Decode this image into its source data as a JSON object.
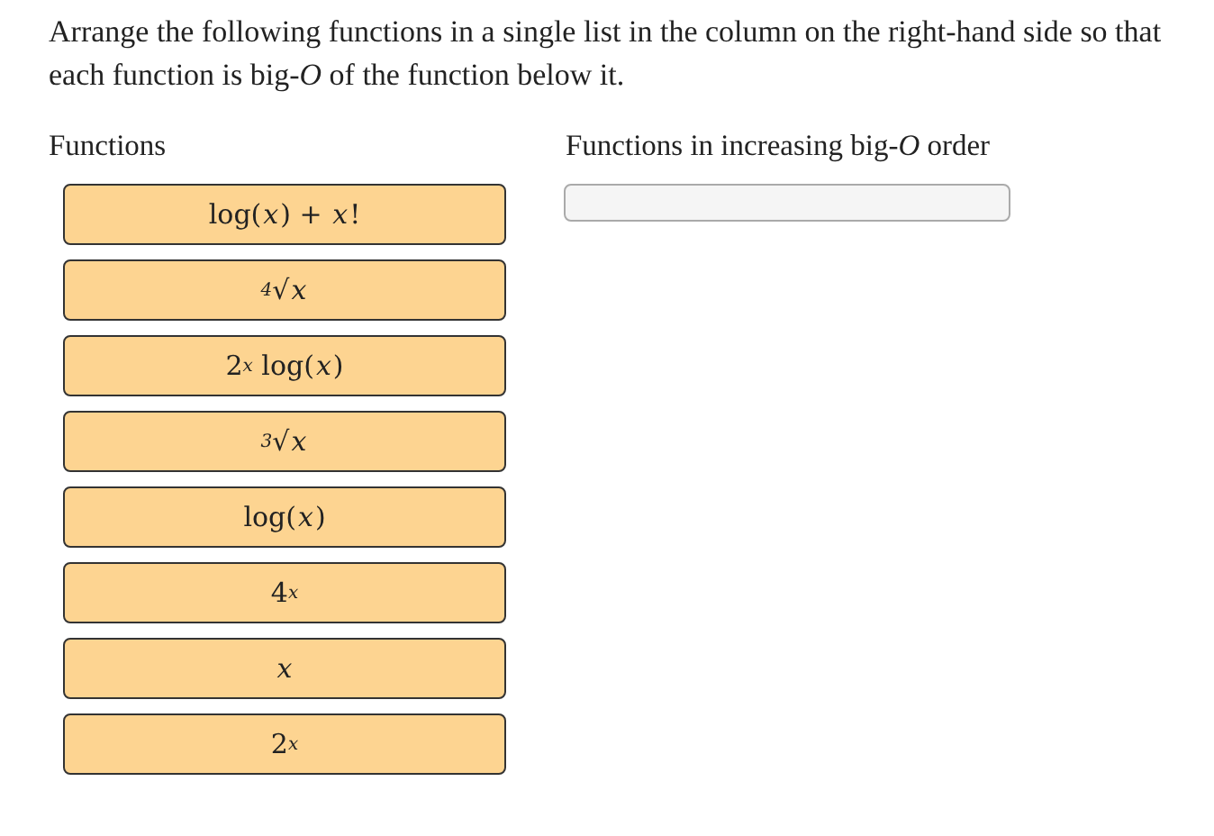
{
  "instruction": "Arrange the following functions in a single list in the column on the right-hand side so that each function is big-*O* of the function below it.",
  "source_list": {
    "heading": "Functions",
    "items": [
      {
        "label": "log(*x*) + *x*!"
      },
      {
        "label": "$^{4}$√*x*"
      },
      {
        "label": "2$^{x}$ log(*x*)"
      },
      {
        "label": "$^{3}$√*x*"
      },
      {
        "label": "log(*x*)"
      },
      {
        "label": "4$^{x}$"
      },
      {
        "label": "*x*"
      },
      {
        "label": "2$^{x}$"
      }
    ]
  },
  "target_list": {
    "heading": "Functions in increasing big-*O* order"
  }
}
